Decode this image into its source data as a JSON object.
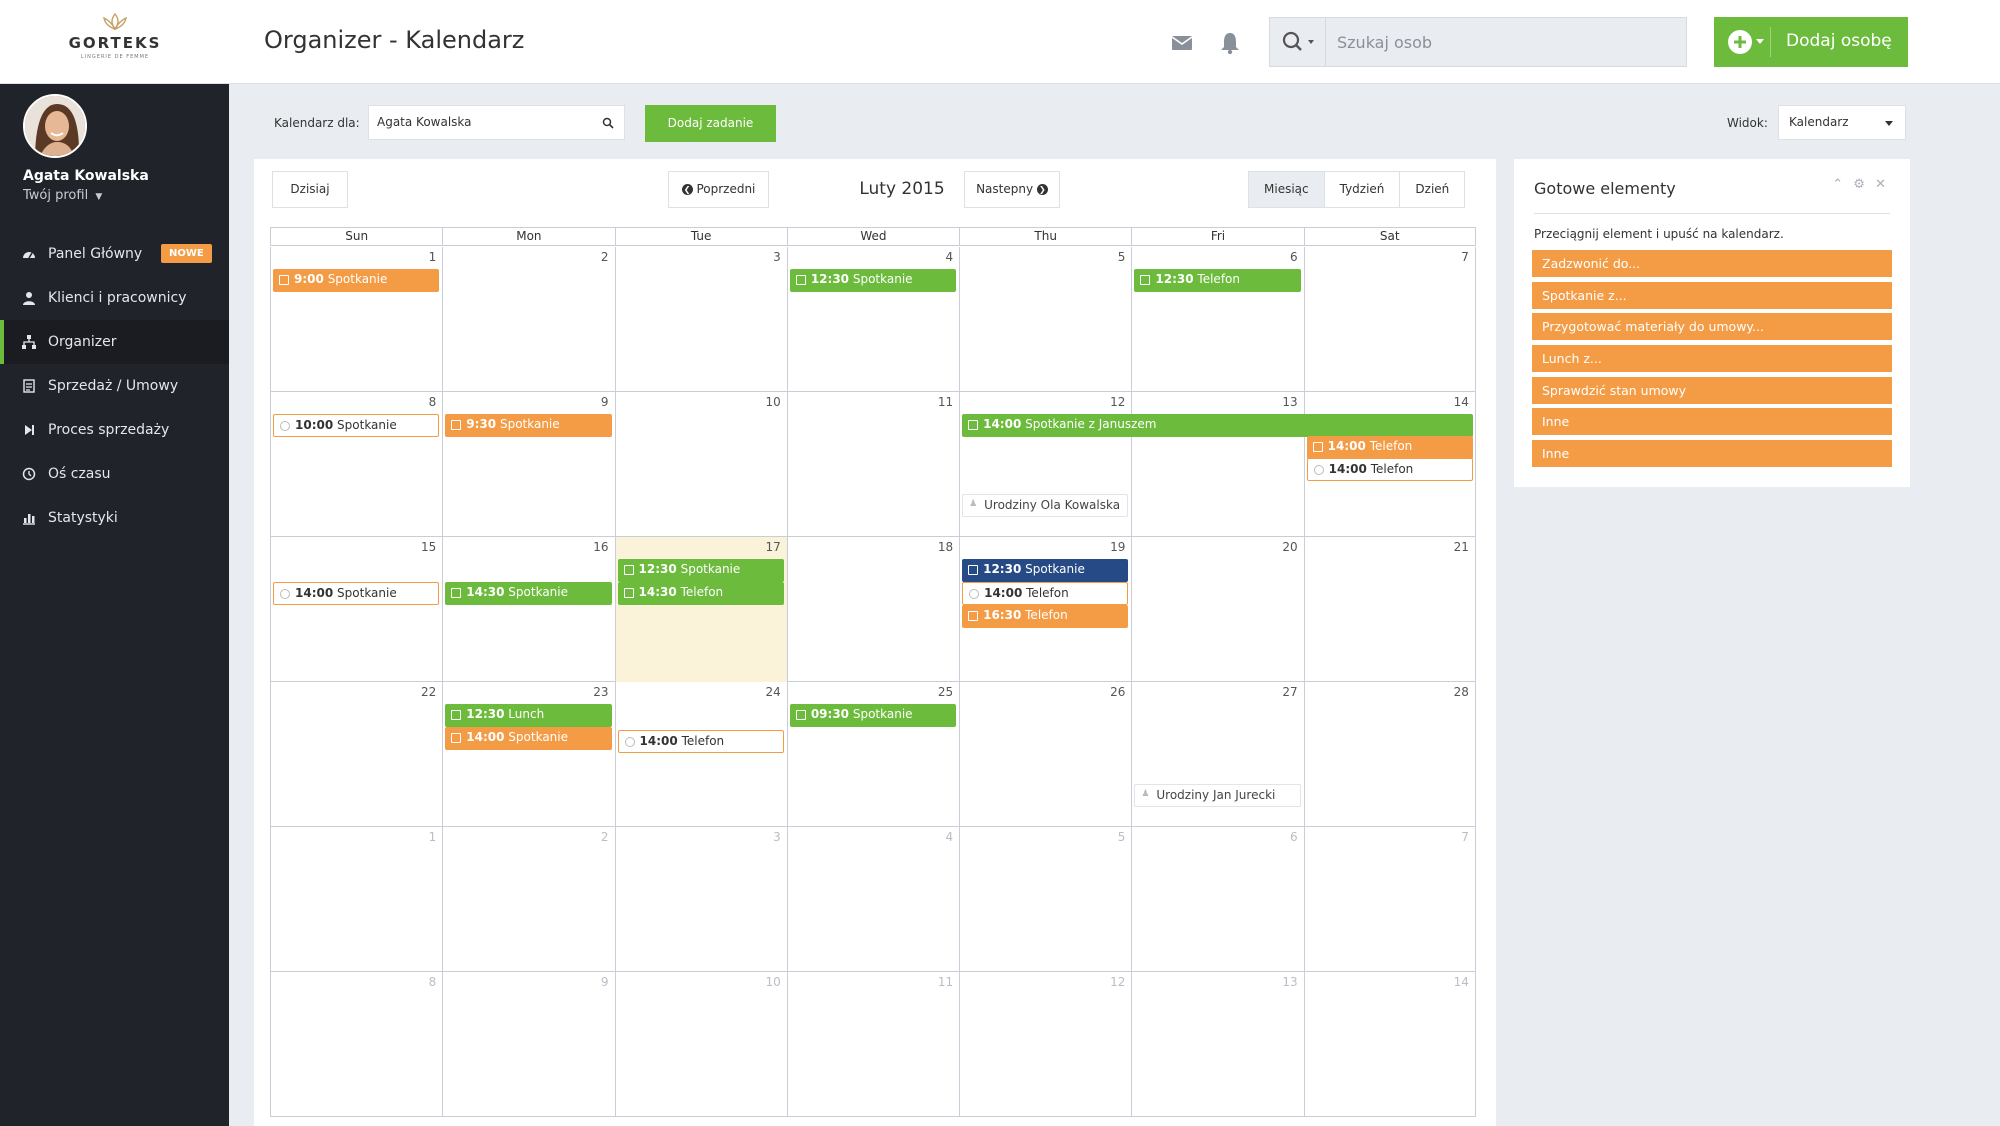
{
  "brand": {
    "name": "GORTEKS",
    "tagline": "LINGERIE DE FEMME"
  },
  "header": {
    "title": "Organizer - Kalendarz",
    "search_placeholder": "Szukaj osob",
    "add_person_label": "Dodaj osobę"
  },
  "user": {
    "name": "Agata Kowalska",
    "profile_link": "Twój profil"
  },
  "sidebar": {
    "items": [
      {
        "label": "Panel Główny",
        "icon": "dashboard-icon",
        "badge": "NOWE"
      },
      {
        "label": "Klienci i pracownicy",
        "icon": "user-icon"
      },
      {
        "label": "Organizer",
        "icon": "sitemap-icon",
        "active": true
      },
      {
        "label": "Sprzedaż / Umowy",
        "icon": "document-icon"
      },
      {
        "label": "Proces sprzedaży",
        "icon": "step-icon"
      },
      {
        "label": "Oś czasu",
        "icon": "history-icon"
      },
      {
        "label": "Statystyki",
        "icon": "chart-icon"
      }
    ]
  },
  "toolbar": {
    "calendar_for_label": "Kalendarz dla:",
    "calendar_for_value": "Agata Kowalska",
    "add_task_label": "Dodaj zadanie",
    "view_label": "Widok:",
    "view_value": "Kalendarz"
  },
  "calendar": {
    "today_label": "Dzisiaj",
    "prev_label": "Poprzedni",
    "next_label": "Nastepny",
    "month_label": "Luty 2015",
    "view_tabs": [
      "Miesiąc",
      "Tydzień",
      "Dzień"
    ],
    "active_view": "Miesiąc",
    "weekdays": [
      "Sun",
      "Mon",
      "Tue",
      "Wed",
      "Thu",
      "Fri",
      "Sat"
    ],
    "weeks": [
      [
        1,
        2,
        3,
        4,
        5,
        6,
        7
      ],
      [
        8,
        9,
        10,
        11,
        12,
        13,
        14
      ],
      [
        15,
        16,
        17,
        18,
        19,
        20,
        21
      ],
      [
        22,
        23,
        24,
        25,
        26,
        27,
        28
      ],
      [
        1,
        2,
        3,
        4,
        5,
        6,
        7
      ],
      [
        8,
        9,
        10,
        11,
        12,
        13,
        14
      ]
    ],
    "today_date": 17,
    "events": [
      {
        "week": 0,
        "day": 0,
        "span": 1,
        "slot": 0,
        "time": "9:00",
        "title": "Spotkanie",
        "style": "orange"
      },
      {
        "week": 0,
        "day": 3,
        "span": 1,
        "slot": 0,
        "time": "12:30",
        "title": "Spotkanie",
        "style": "green"
      },
      {
        "week": 0,
        "day": 5,
        "span": 1,
        "slot": 0,
        "time": "12:30",
        "title": "Telefon",
        "style": "green"
      },
      {
        "week": 1,
        "day": 0,
        "span": 1,
        "slot": 0,
        "time": "10:00",
        "title": "Spotkanie",
        "style": "outline"
      },
      {
        "week": 1,
        "day": 1,
        "span": 1,
        "slot": 0,
        "time": "9:30",
        "title": "Spotkanie",
        "style": "orange"
      },
      {
        "week": 1,
        "day": 4,
        "span": 3,
        "slot": 0,
        "time": "14:00",
        "title": "Spotkanie z Januszem",
        "style": "green"
      },
      {
        "week": 1,
        "day": 6,
        "span": 1,
        "slot": 1,
        "time": "14:00",
        "title": "Telefon",
        "style": "orange"
      },
      {
        "week": 1,
        "day": 6,
        "span": 1,
        "slot": 2,
        "time": "14:00",
        "title": "Telefon",
        "style": "outline"
      },
      {
        "week": 1,
        "day": 4,
        "span": 1,
        "slot": 3,
        "time": "",
        "title": "Urodziny Ola Kowalska",
        "style": "plain"
      },
      {
        "week": 2,
        "day": 0,
        "span": 1,
        "slot": 1,
        "time": "14:00",
        "title": "Spotkanie",
        "style": "outline"
      },
      {
        "week": 2,
        "day": 1,
        "span": 1,
        "slot": 1,
        "time": "14:30",
        "title": "Spotkanie",
        "style": "green"
      },
      {
        "week": 2,
        "day": 2,
        "span": 1,
        "slot": 0,
        "time": "12:30",
        "title": "Spotkanie",
        "style": "green"
      },
      {
        "week": 2,
        "day": 2,
        "span": 1,
        "slot": 1,
        "time": "14:30",
        "title": "Telefon",
        "style": "green"
      },
      {
        "week": 2,
        "day": 4,
        "span": 1,
        "slot": 0,
        "time": "12:30",
        "title": "Spotkanie",
        "style": "navy"
      },
      {
        "week": 2,
        "day": 4,
        "span": 1,
        "slot": 1,
        "time": "14:00",
        "title": "Telefon",
        "style": "outline"
      },
      {
        "week": 2,
        "day": 4,
        "span": 1,
        "slot": 2,
        "time": "16:30",
        "title": "Telefon",
        "style": "orange"
      },
      {
        "week": 3,
        "day": 1,
        "span": 1,
        "slot": 0,
        "time": "12:30",
        "title": "Lunch",
        "style": "green"
      },
      {
        "week": 3,
        "day": 1,
        "span": 1,
        "slot": 1,
        "time": "14:00",
        "title": "Spotkanie",
        "style": "orange"
      },
      {
        "week": 3,
        "day": 3,
        "span": 1,
        "slot": 0,
        "time": "09:30",
        "title": "Spotkanie",
        "style": "green"
      },
      {
        "week": 3,
        "day": 2,
        "span": 1,
        "slot": 1,
        "time": "14:00",
        "title": "Telefon",
        "style": "outline"
      },
      {
        "week": 3,
        "day": 5,
        "span": 1,
        "slot": 3,
        "time": "",
        "title": "Urodziny Jan Jurecki",
        "style": "plain"
      }
    ]
  },
  "ready_panel": {
    "title": "Gotowe elementy",
    "hint": "Przeciągnij element i upuść na kalendarz.",
    "items": [
      "Zadzwonić do...",
      "Spotkanie z...",
      "Przygotować materiały do umowy...",
      "Lunch z...",
      "Sprawdzić stan umowy",
      "Inne",
      "Inne"
    ]
  },
  "colors": {
    "green": "#6cbb3c",
    "orange": "#f39c45",
    "navy": "#264a86",
    "sidebar_bg": "#20232a",
    "today_bg": "#faf3d9"
  }
}
